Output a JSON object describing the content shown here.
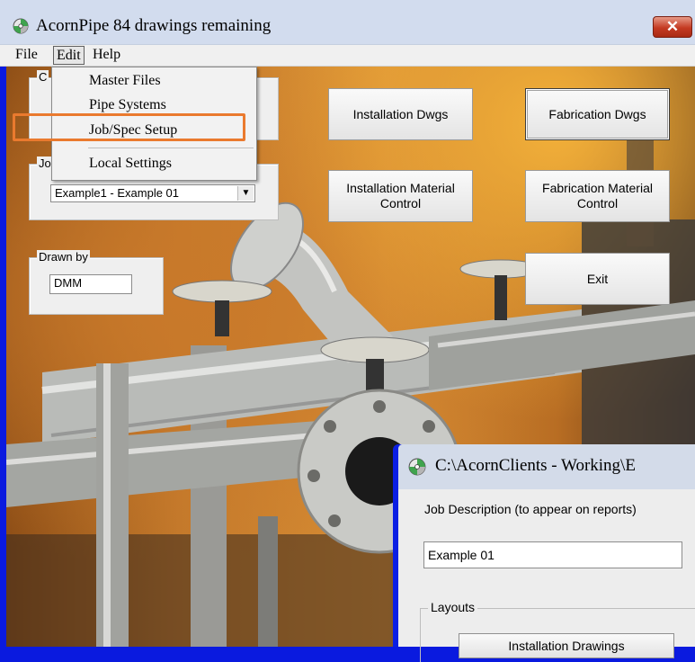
{
  "window": {
    "title": "AcornPipe  84 drawings remaining",
    "close_label": "✕"
  },
  "menubar": {
    "file": "File",
    "edit": "Edit",
    "help": "Help"
  },
  "edit_menu": {
    "items": [
      "Master Files",
      "Pipe Systems",
      "Job/Spec Setup",
      "Local Settings"
    ],
    "highlighted": "Job/Spec Setup"
  },
  "left_panel": {
    "group1_legend_partial": "C",
    "job_legend_partial": "Jo",
    "job_combo_value": "Example1 - Example 01",
    "combo_arrow": "▼",
    "drawn_by_legend": "Drawn by",
    "drawn_by_value": "DMM"
  },
  "buttons": {
    "installation_dwgs": "Installation Dwgs",
    "fabrication_dwgs": "Fabrication Dwgs",
    "installation_mc": "Installation Material Control",
    "fabrication_mc": "Fabrication Material Control",
    "exit": "Exit"
  },
  "job_dialog": {
    "title": "C:\\AcornClients - Working\\E",
    "description_label": "Job Description (to appear on reports)",
    "description_value": "Example 01",
    "layouts_legend": "Layouts",
    "installation_drawings_button": "Installation Drawings"
  },
  "colors": {
    "frame_blue": "#0a1adf",
    "highlight_orange": "#ea7a2e",
    "close_red": "#c43a22"
  }
}
